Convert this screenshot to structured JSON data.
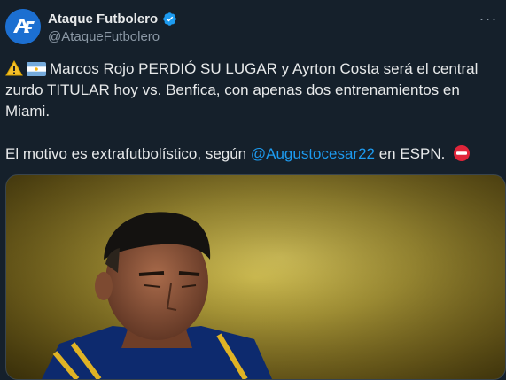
{
  "author": {
    "name": "Ataque Futbolero",
    "handle": "@AtaqueFutbolero",
    "verified": true,
    "avatar_letters": "AF",
    "avatar_color": "#1c6fd1"
  },
  "menu_icon": "more-horizontal-icon",
  "tweet": {
    "line1": "Marcos Rojo PERDIÓ SU LUGAR y Ayrton Costa será el central",
    "line2": "zurdo TITULAR hoy vs. Benfica, con apenas dos entrenamientos en",
    "line3": "Miami.",
    "line4_before": "El motivo es extrafutbolístico, según ",
    "mention": "@Augustocesar22",
    "line4_after": " en ESPN."
  },
  "icons": {
    "warning": "warning-icon",
    "flag": "argentina-flag-icon",
    "no_entry": "no-entry-icon"
  },
  "colors": {
    "background": "#15202b",
    "text": "#e7e9ea",
    "secondary": "#8b98a5",
    "link": "#1d9bf0",
    "verified": "#1d9bf0"
  },
  "media": {
    "type": "photo"
  }
}
